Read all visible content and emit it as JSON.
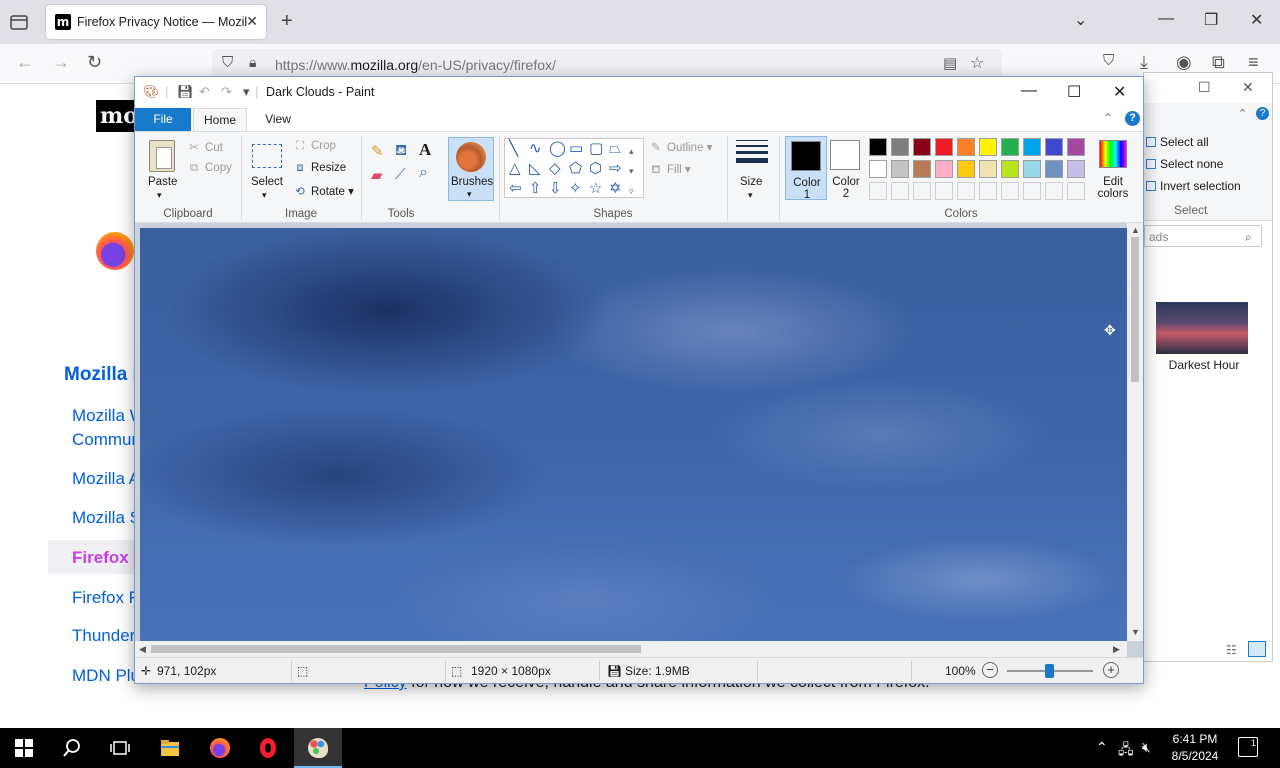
{
  "browser": {
    "tab_title": "Firefox Privacy Notice — Mozilla",
    "tab_favicon": "m",
    "url_prefix": "https://www.",
    "url_domain": "mozilla.org",
    "url_path": "/en-US/privacy/firefox/"
  },
  "webpage": {
    "logo_text": "mo",
    "sidebar_heading": "Mozilla I",
    "sidebar_links": [
      "Mozilla W",
      "Commun",
      "Mozilla A",
      "Mozilla S",
      "Firefox I",
      "Firefox F",
      "Thunder",
      "MDN Plu"
    ],
    "policy_link": "Policy",
    "policy_text": " for how we receive, handle and share information we collect from Firefox."
  },
  "explorer": {
    "select_all": "Select all",
    "select_none": "Select none",
    "invert_selection": "Invert selection",
    "group_label": "Select",
    "search_placeholder": "ads",
    "thumbnail_label": "Darkest Hour"
  },
  "paint": {
    "title": "Dark Clouds - Paint",
    "tabs": {
      "file": "File",
      "home": "Home",
      "view": "View"
    },
    "clipboard": {
      "paste": "Paste",
      "cut": "Cut",
      "copy": "Copy",
      "label": "Clipboard"
    },
    "image": {
      "select": "Select",
      "crop": "Crop",
      "resize": "Resize",
      "rotate": "Rotate",
      "label": "Image"
    },
    "tools": {
      "label": "Tools"
    },
    "brushes": {
      "label": "Brushes"
    },
    "shapes": {
      "outline": "Outline",
      "fill": "Fill",
      "label": "Shapes"
    },
    "size": {
      "label": "Size"
    },
    "colors": {
      "color1": "Color",
      "color1_num": "1",
      "color2": "Color",
      "color2_num": "2",
      "edit1": "Edit",
      "edit2": "colors",
      "label": "Colors",
      "color1_value": "#000000",
      "color2_value": "#ffffff",
      "palette_row1": [
        "#000000",
        "#7f7f7f",
        "#880015",
        "#ed1c24",
        "#ff7f27",
        "#fff200",
        "#22b14c",
        "#00a2e8",
        "#3f48cc",
        "#a349a4"
      ],
      "palette_row2": [
        "#ffffff",
        "#c3c3c3",
        "#b97a57",
        "#ffaec9",
        "#ffc90e",
        "#efe4b0",
        "#b5e61d",
        "#99d9ea",
        "#7092be",
        "#c8bfe7"
      ]
    },
    "status": {
      "cursor_pos": "971, 102px",
      "dimensions": "1920 × 1080px",
      "size": "Size: 1.9MB",
      "zoom": "100%"
    }
  },
  "taskbar": {
    "time": "6:41 PM",
    "date": "8/5/2024",
    "notification_count": "1"
  }
}
